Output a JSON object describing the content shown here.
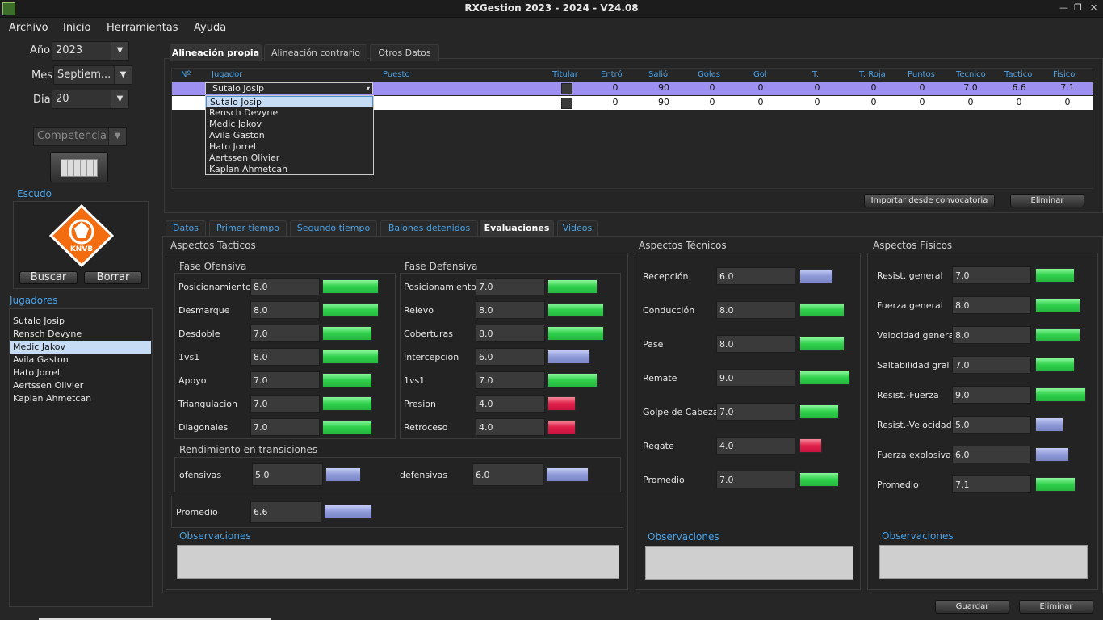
{
  "window": {
    "title": "RXGestion 2023 - 2024 - V24.08",
    "min": "—",
    "restore": "❐",
    "close": "✕"
  },
  "menu": [
    "Archivo",
    "Inicio",
    "Herramientas",
    "Ayuda"
  ],
  "filters": {
    "ano_label": "Año",
    "ano_value": "2023",
    "mes_label": "Mes",
    "mes_value": "Septiem...",
    "dia_label": "Dia",
    "dia_value": "20",
    "competencia": "Competencia"
  },
  "escudo": {
    "label": "Escudo",
    "logo_text": "KNVB",
    "buscar": "Buscar",
    "borrar": "Borrar"
  },
  "jugadores": {
    "label": "Jugadores",
    "items": [
      "Sutalo Josip",
      "Rensch Devyne",
      "Medic Jakov",
      "Avila Gaston",
      "Hato Jorrel",
      "Aertssen Olivier",
      "Kaplan Ahmetcan"
    ],
    "selected_index": 2
  },
  "top_tabs": [
    "Alineación propia",
    "Alineación contrario",
    "Otros Datos"
  ],
  "table": {
    "headers": [
      "Nº",
      "Jugador",
      "Puesto",
      "Titular",
      "Entró",
      "Salió",
      "Goles",
      "Gol",
      "T.",
      "T. Roja",
      "Puntos",
      "Tecnico",
      "Tactico",
      "Fisico"
    ],
    "rows": [
      {
        "jugador": "Sutalo Josip",
        "entro": "0",
        "salio": "90",
        "goles": "0",
        "gol": "0",
        "t": "0",
        "t_roja": "0",
        "puntos": "0",
        "tecnico": "7.0",
        "tactico": "6.6",
        "fisico": "7.1"
      },
      {
        "jugador": "",
        "entro": "0",
        "salio": "90",
        "goles": "0",
        "gol": "0",
        "t": "0",
        "t_roja": "0",
        "puntos": "0",
        "tecnico": "0",
        "tactico": "0",
        "fisico": "0"
      }
    ],
    "dropdown": [
      "Sutalo Josip",
      "Rensch Devyne",
      "Medic Jakov",
      "Avila Gaston",
      "Hato Jorrel",
      "Aertssen Olivier",
      "Kaplan Ahmetcan"
    ],
    "importar": "Importar desde convocatoria",
    "eliminar": "Eliminar"
  },
  "sub_tabs": [
    "Datos",
    "Primer tiempo",
    "Segundo tiempo",
    "Balones detenidos",
    "Evaluaciones",
    "Videos"
  ],
  "tacticos": {
    "title": "Aspectos Tacticos",
    "ofensiva_title": "Fase Ofensiva",
    "ofensiva": [
      {
        "label": "Posicionamiento",
        "value": "8.0",
        "level": 0.8,
        "color": "g"
      },
      {
        "label": "Desmarque",
        "value": "8.0",
        "level": 0.8,
        "color": "g"
      },
      {
        "label": "Desdoble",
        "value": "7.0",
        "level": 0.7,
        "color": "g"
      },
      {
        "label": "1vs1",
        "value": "8.0",
        "level": 0.8,
        "color": "g"
      },
      {
        "label": "Apoyo",
        "value": "7.0",
        "level": 0.7,
        "color": "g"
      },
      {
        "label": "Triangulacion",
        "value": "7.0",
        "level": 0.7,
        "color": "g"
      },
      {
        "label": "Diagonales",
        "value": "7.0",
        "level": 0.7,
        "color": "g"
      }
    ],
    "defensiva_title": "Fase Defensiva",
    "defensiva": [
      {
        "label": "Posicionamiento",
        "value": "7.0",
        "level": 0.7,
        "color": "g"
      },
      {
        "label": "Relevo",
        "value": "8.0",
        "level": 0.8,
        "color": "g"
      },
      {
        "label": "Coberturas",
        "value": "8.0",
        "level": 0.8,
        "color": "g"
      },
      {
        "label": "Intercepcion",
        "value": "6.0",
        "level": 0.6,
        "color": "b"
      },
      {
        "label": "1vs1",
        "value": "7.0",
        "level": 0.7,
        "color": "g"
      },
      {
        "label": "Presion",
        "value": "4.0",
        "level": 0.4,
        "color": "r"
      },
      {
        "label": "Retroceso",
        "value": "4.0",
        "level": 0.4,
        "color": "r"
      }
    ],
    "transiciones_title": "Rendimiento en transiciones",
    "ofensivas_label": "ofensivas",
    "ofensivas_value": "5.0",
    "ofensivas_level": 0.5,
    "defensivas_label": "defensivas",
    "defensivas_value": "6.0",
    "defensivas_level": 0.6,
    "promedio_label": "Promedio",
    "promedio_value": "6.6",
    "promedio_level": 0.66,
    "observaciones": "Observaciones"
  },
  "tecnicos": {
    "title": "Aspectos Técnicos",
    "items": [
      {
        "label": "Recepción",
        "value": "6.0",
        "level": 0.6,
        "color": "b"
      },
      {
        "label": "Conducción",
        "value": "8.0",
        "level": 0.8,
        "color": "g"
      },
      {
        "label": "Pase",
        "value": "8.0",
        "level": 0.8,
        "color": "g"
      },
      {
        "label": "Remate",
        "value": "9.0",
        "level": 0.9,
        "color": "g"
      },
      {
        "label": "Golpe de Cabeza",
        "value": "7.0",
        "level": 0.7,
        "color": "g"
      },
      {
        "label": "Regate",
        "value": "4.0",
        "level": 0.4,
        "color": "r"
      },
      {
        "label": "Promedio",
        "value": "7.0",
        "level": 0.7,
        "color": "g"
      }
    ],
    "observaciones": "Observaciones"
  },
  "fisicos": {
    "title": "Aspectos Físicos",
    "items": [
      {
        "label": "Resist. general",
        "value": "7.0",
        "level": 0.7,
        "color": "g"
      },
      {
        "label": "Fuerza general",
        "value": "8.0",
        "level": 0.8,
        "color": "g"
      },
      {
        "label": "Velocidad general",
        "value": "8.0",
        "level": 0.8,
        "color": "g"
      },
      {
        "label": "Saltabilidad gral",
        "value": "7.0",
        "level": 0.7,
        "color": "g"
      },
      {
        "label": "Resist.-Fuerza",
        "value": "9.0",
        "level": 0.9,
        "color": "g"
      },
      {
        "label": "Resist.-Velocidad",
        "value": "5.0",
        "level": 0.5,
        "color": "b"
      },
      {
        "label": "Fuerza explosiva",
        "value": "6.0",
        "level": 0.6,
        "color": "b"
      },
      {
        "label": "Promedio",
        "value": "7.1",
        "level": 0.71,
        "color": "g"
      }
    ],
    "observaciones": "Observaciones"
  },
  "footer": {
    "guardar": "Guardar",
    "eliminar": "Eliminar"
  }
}
